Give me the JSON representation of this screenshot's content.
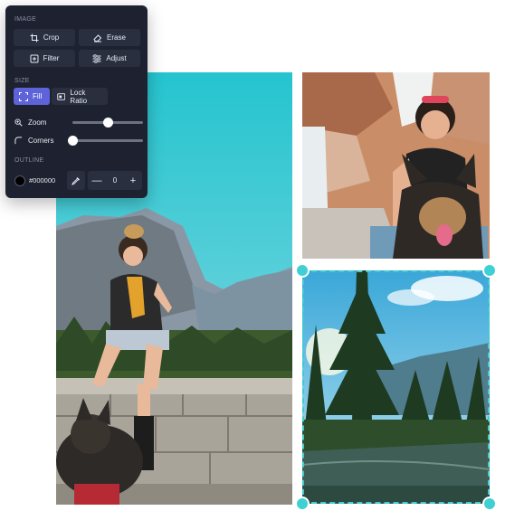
{
  "panel": {
    "image_section": "IMAGE",
    "tools": {
      "crop": "Crop",
      "erase": "Erase",
      "filter": "Filter",
      "adjust": "Adjust"
    },
    "size_section": "SIZE",
    "fill": "Fill",
    "lock_ratio": "Lock Ratio",
    "zoom": {
      "label": "Zoom",
      "level": 0.5
    },
    "corners": {
      "label": "Corners",
      "level": 0.0
    },
    "outline_section": "OUTLINE",
    "outline": {
      "color_hex": "#000000",
      "width_value": "0",
      "minus": "—",
      "plus": "+"
    }
  },
  "canvas": {
    "photos": [
      {
        "name": "mountain-portrait-photo",
        "subject": "woman sitting on stone wall with dog in mountain valley"
      },
      {
        "name": "dog-portrait-photo",
        "subject": "woman with dog by waterfall"
      },
      {
        "name": "forest-river-photo",
        "subject": "pine forest and river under blue sky"
      }
    ]
  },
  "colors": {
    "panel_bg": "#1e2230",
    "button_bg": "#2a2f40",
    "accent": "#5e63d9",
    "selection": "#3fd0d4"
  }
}
